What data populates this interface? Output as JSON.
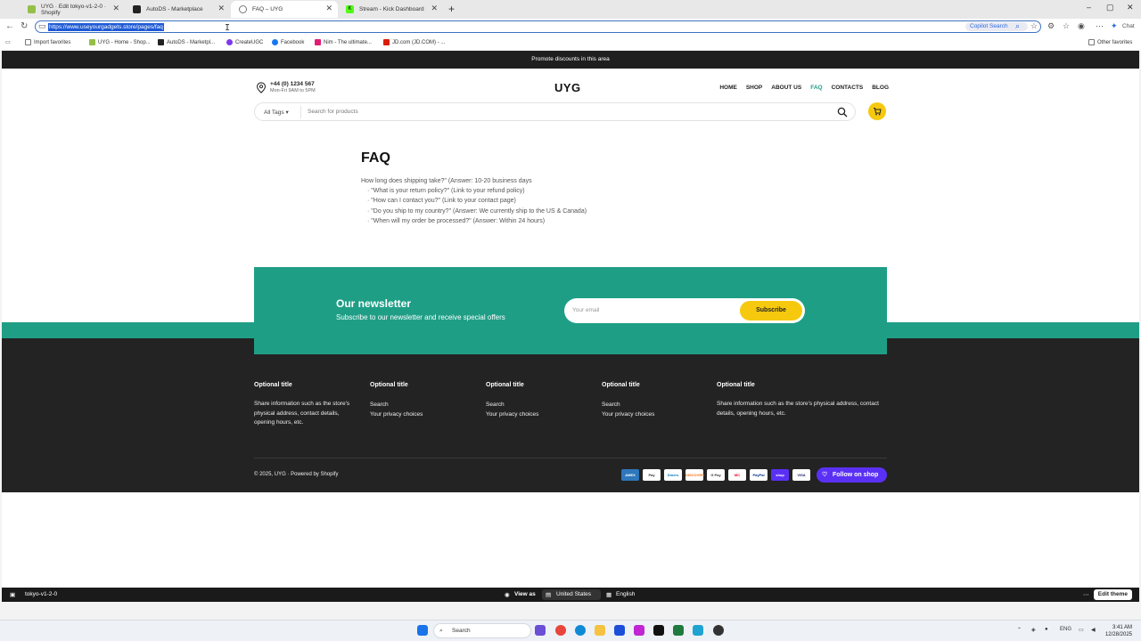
{
  "browser": {
    "tabs": [
      {
        "title": "UYG · Edit tokyo-v1-2-0 · Shopify",
        "active": false,
        "icon": "shopify-icon"
      },
      {
        "title": "AutoDS - Marketplace",
        "active": false,
        "icon": "autods-icon"
      },
      {
        "title": "FAQ – UYG",
        "active": true,
        "icon": "globe-icon"
      },
      {
        "title": "Stream - Kick Dashboard",
        "active": false,
        "icon": "kick-icon"
      }
    ],
    "new_tab": "+",
    "window": {
      "minimize": "–",
      "maximize": "▢",
      "close": "✕"
    },
    "url": "https://www.useyourgadgets.store/pages/faq",
    "copilot_search": "Copilot Search",
    "chat_label": "Chat",
    "favorites": [
      {
        "label": "Import favorites",
        "color": "#777"
      },
      {
        "label": "UYG - Home - Shop...",
        "color": "#95bf47"
      },
      {
        "label": "AutoDS - Marketpl...",
        "color": "#222"
      },
      {
        "label": "CreateUGC",
        "color": "#7c3aed"
      },
      {
        "label": "Facebook",
        "color": "#1877f2"
      },
      {
        "label": "Nim - The ultimate...",
        "color": "#e11d74"
      },
      {
        "label": "JD.com (JD.COM) - ...",
        "color": "#d81e06"
      }
    ],
    "other_favorites": "Other favorites"
  },
  "store": {
    "announcement": "Promote discounts in this area",
    "phone": "+44 (0) 1234 567",
    "hours": "Mon-Fri 9AM to 5PM",
    "logo": "UYG",
    "nav": [
      "HOME",
      "SHOP",
      "ABOUT US",
      "FAQ",
      "CONTACTS",
      "BLOG"
    ],
    "nav_active": "FAQ",
    "search": {
      "tags_label": "All Tags",
      "placeholder": "Search for products"
    },
    "accent": "#1f9e86",
    "yellow": "#f6c90e"
  },
  "faq": {
    "title": "FAQ",
    "lines": [
      "How long does shipping take?\" (Answer: 10-20 business days",
      "· \"What is your return policy?\" (Link to your refund policy)",
      "· \"How can I contact you?\" (Link to your contact page)",
      "· \"Do you ship to my country?\" (Answer: We currently ship to the US & Canada)",
      "· \"When will my order be processed?\" (Answer: Within 24 hours)"
    ]
  },
  "newsletter": {
    "title": "Our newsletter",
    "subtitle": "Subscribe to our newsletter and receive special offers",
    "placeholder": "Your email",
    "button": "Subscribe"
  },
  "footer": {
    "columns": [
      {
        "title": "Optional title",
        "text": "Share information such as the store's physical address, contact details, opening hours, etc.",
        "links": []
      },
      {
        "title": "Optional title",
        "text": "",
        "links": [
          "Search",
          "Your privacy choices"
        ]
      },
      {
        "title": "Optional title",
        "text": "",
        "links": [
          "Search",
          "Your privacy choices"
        ]
      },
      {
        "title": "Optional title",
        "text": "",
        "links": [
          "Search",
          "Your privacy choices"
        ]
      },
      {
        "title": "Optional title",
        "text": "Share information such as the store's physical address, contact details, opening hours, etc.",
        "links": []
      }
    ],
    "copyright": "© 2025, UYG · Powered by Shopify",
    "payments": [
      "AMEX",
      "Pay",
      "Diners",
      "DISCOVER",
      "G Pay",
      "MC",
      "PayPal",
      "shop",
      "VISA"
    ],
    "follow": "Follow on shop"
  },
  "preview_bar": {
    "theme": "tokyo-v1-2-0",
    "view_as": "View as",
    "country": "United States",
    "language": "English",
    "edit": "Edit theme"
  },
  "taskbar": {
    "search": "Search",
    "lang": "ENG",
    "time": "3:41 AM",
    "date": "12/28/2025"
  }
}
